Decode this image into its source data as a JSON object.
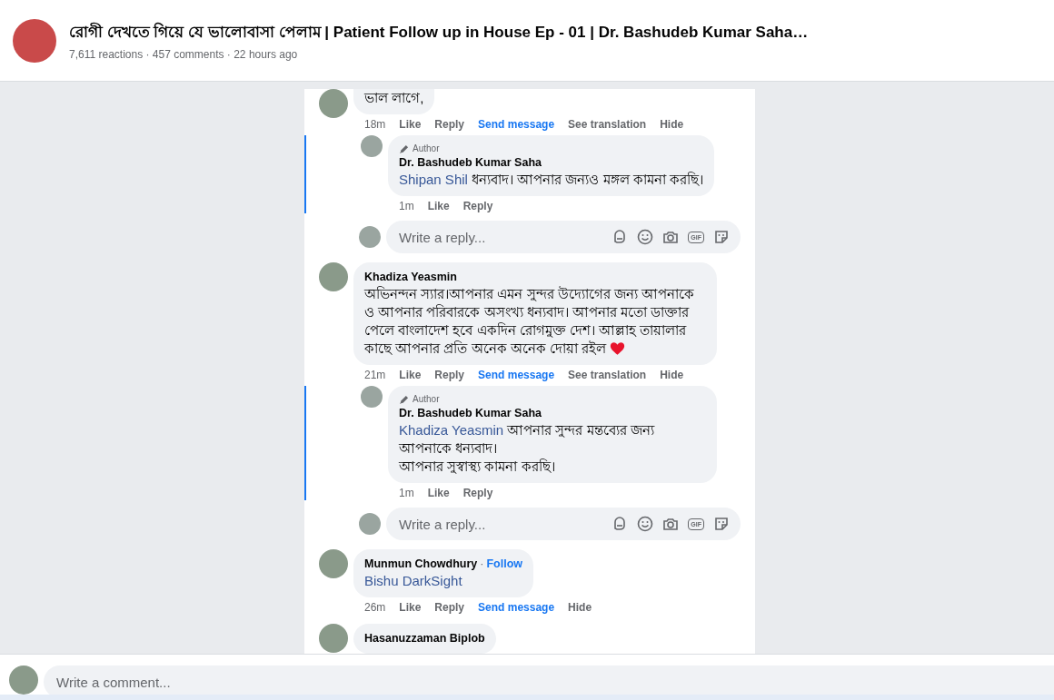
{
  "header": {
    "title": "রোগী দেখতে গিয়ে যে ভালোবাসা পেলাম | Patient Follow up in House Ep - 01 | Dr. Bashudeb Kumar Saha…",
    "meta": "7,611 reactions · 457 comments · 22 hours ago"
  },
  "comments": [
    {
      "text": "ভাল লাগে,",
      "actions": [
        {
          "label": "18m",
          "kind": "time"
        },
        {
          "label": "Like",
          "kind": "link"
        },
        {
          "label": "Reply",
          "kind": "link"
        },
        {
          "label": "Send message",
          "kind": "accent"
        },
        {
          "label": "See translation",
          "kind": "link"
        },
        {
          "label": "Hide",
          "kind": "link"
        }
      ],
      "replies": [
        {
          "badge": "Author",
          "author": "Dr. Bashudeb Kumar Saha",
          "mention": "Shipan Shil",
          "text": "ধন্যবাদ। আপনার জন্যও মঙ্গল কামনা করছি।",
          "actions": [
            {
              "label": "1m",
              "kind": "time"
            },
            {
              "label": "Like",
              "kind": "link"
            },
            {
              "label": "Reply",
              "kind": "link"
            }
          ]
        }
      ],
      "reply_box": {
        "placeholder": "Write a reply...",
        "gif_label": "GIF"
      }
    },
    {
      "author": "Khadiza Yeasmin",
      "text": "অভিনন্দন স্যার।আপনার এমন সুন্দর উদ্যোগের জন্য আপনাকে ও আপনার পরিবারকে অসংখ্য ধন্যবাদ। আপনার মতো ডাক্তার পেলে বাংলাদেশ হবে একদিন রোগমুক্ত দেশ। আল্লাহ তায়ালার কাছে আপনার প্রতি অনেক অনেক দোয়া রইল",
      "heart": true,
      "actions": [
        {
          "label": "21m",
          "kind": "time"
        },
        {
          "label": "Like",
          "kind": "link"
        },
        {
          "label": "Reply",
          "kind": "link"
        },
        {
          "label": "Send message",
          "kind": "accent"
        },
        {
          "label": "See translation",
          "kind": "link"
        },
        {
          "label": "Hide",
          "kind": "link"
        }
      ],
      "replies": [
        {
          "badge": "Author",
          "author": "Dr. Bashudeb Kumar Saha",
          "mention": "Khadiza Yeasmin",
          "text": "আপনার সুন্দর মন্তব্যের জন্য আপনাকে ধন্যবাদ।\nআপনার সুস্বাস্থ্য কামনা করছি।",
          "actions": [
            {
              "label": "1m",
              "kind": "time"
            },
            {
              "label": "Like",
              "kind": "link"
            },
            {
              "label": "Reply",
              "kind": "link"
            }
          ]
        }
      ],
      "reply_box": {
        "placeholder": "Write a reply...",
        "gif_label": "GIF"
      }
    },
    {
      "author": "Munmun Chowdhury",
      "separator": "·",
      "follow": "Follow",
      "mention": "Bishu DarkSight",
      "actions": [
        {
          "label": "26m",
          "kind": "time"
        },
        {
          "label": "Like",
          "kind": "link"
        },
        {
          "label": "Reply",
          "kind": "link"
        },
        {
          "label": "Send message",
          "kind": "accent"
        },
        {
          "label": "Hide",
          "kind": "link"
        }
      ]
    },
    {
      "author": "Hasanuzzaman Biplob"
    }
  ],
  "composer": {
    "placeholder": "Write a comment..."
  }
}
